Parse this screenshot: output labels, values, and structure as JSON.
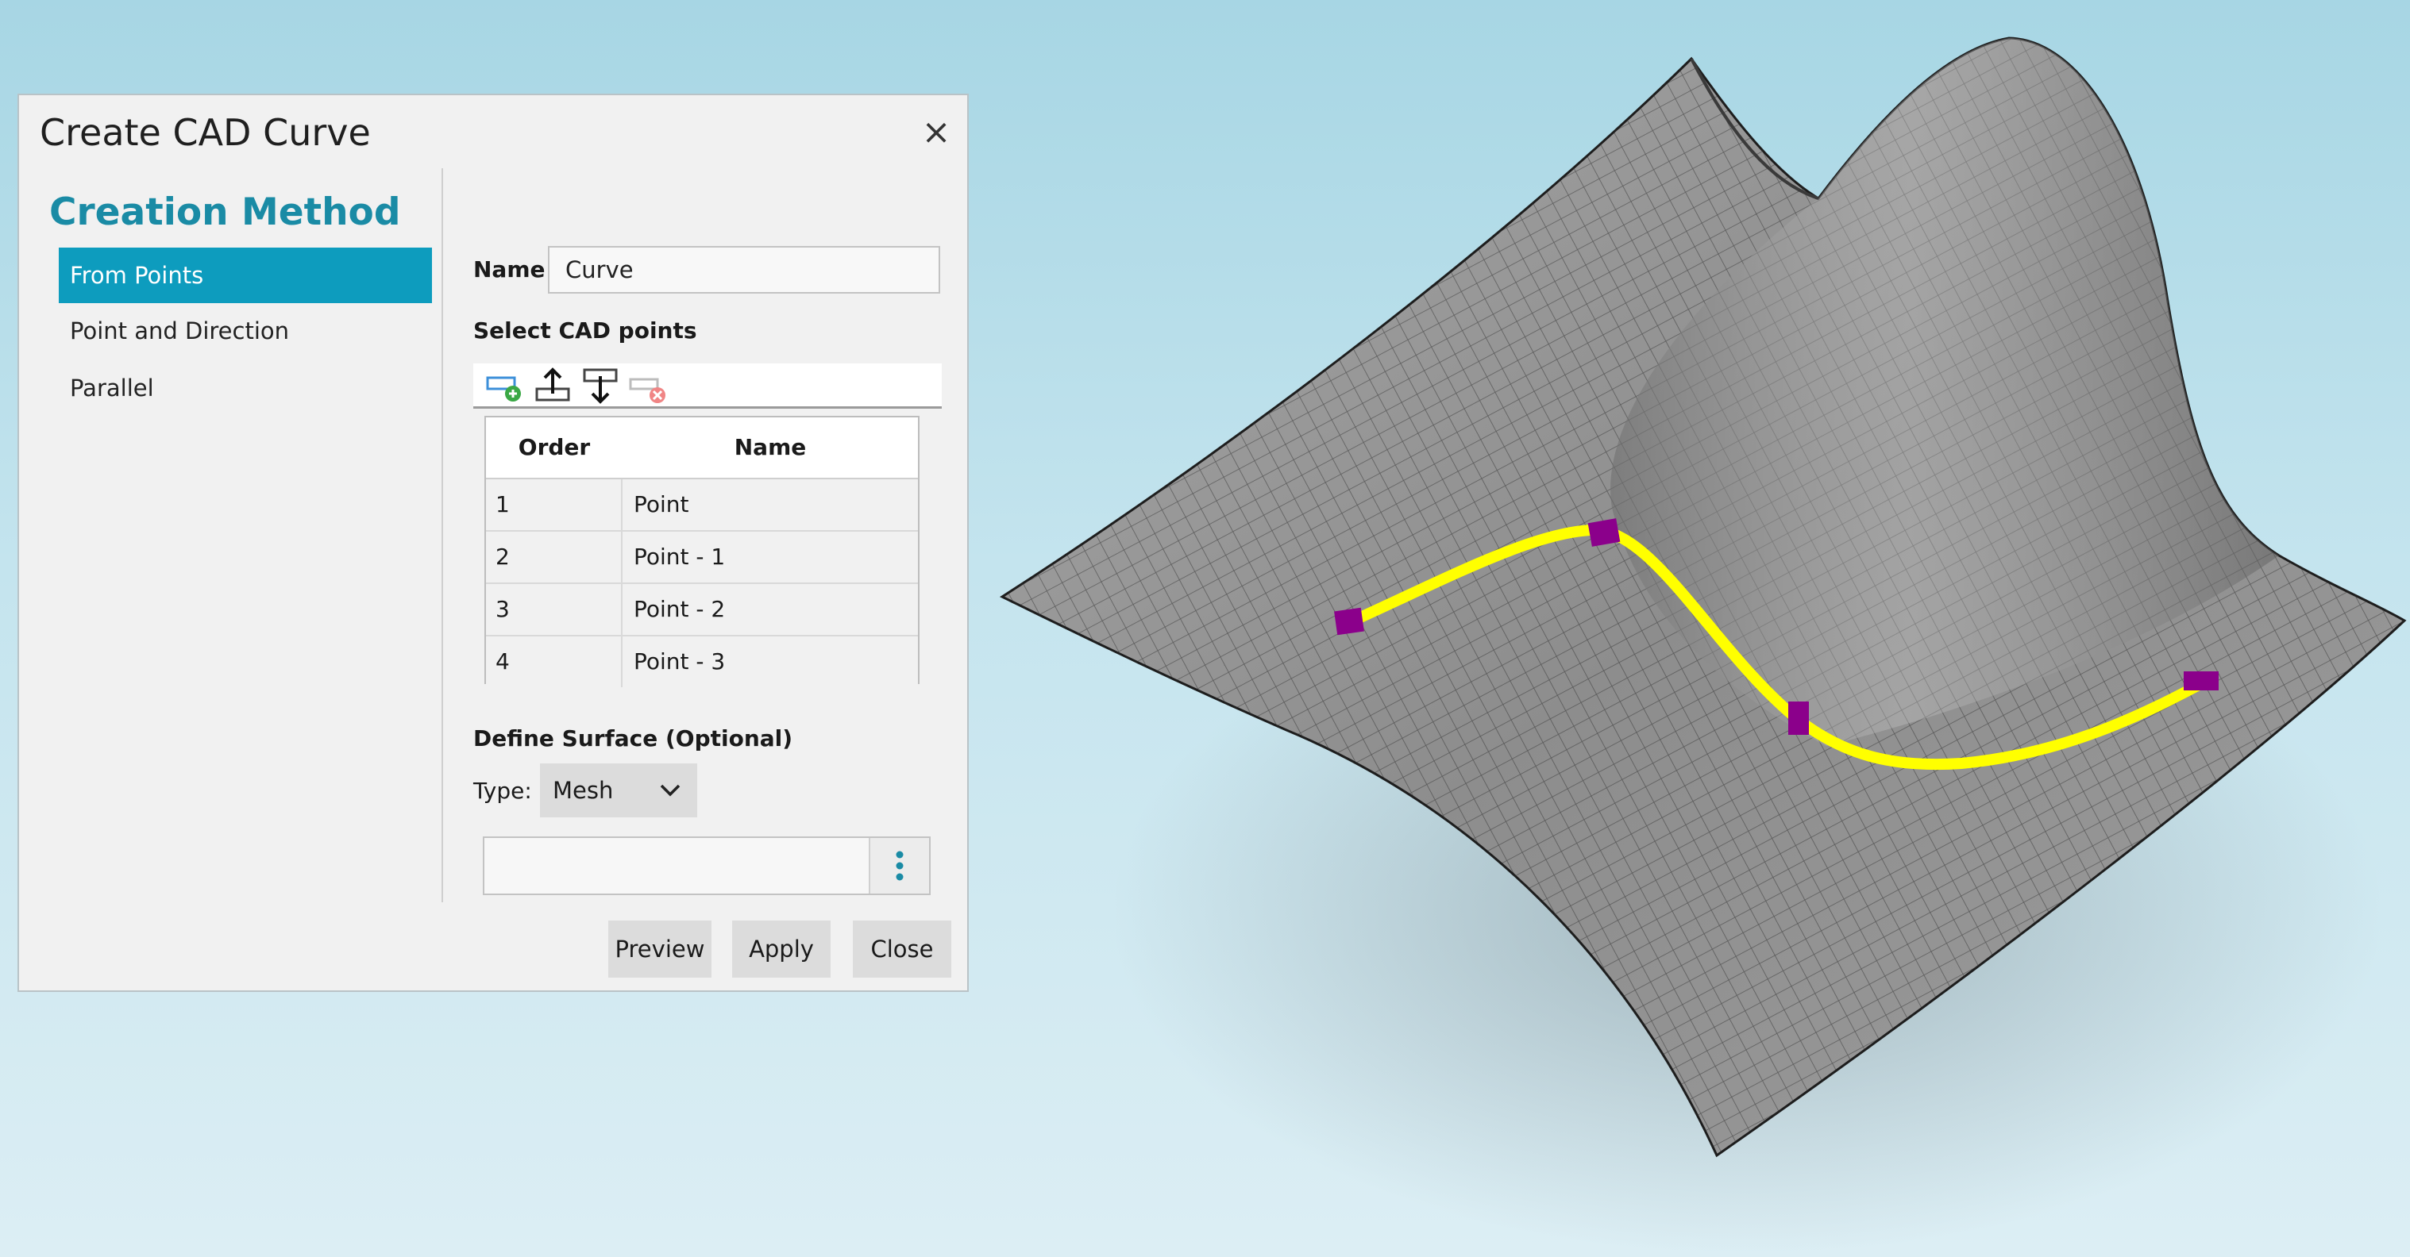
{
  "dialog": {
    "title": "Create CAD Curve",
    "close_label": "×"
  },
  "creation_method": {
    "heading": "Creation Method",
    "items": [
      {
        "label": "From Points",
        "active": true
      },
      {
        "label": "Point and Direction",
        "active": false
      },
      {
        "label": "Parallel",
        "active": false
      }
    ]
  },
  "name_field": {
    "label": "Name",
    "value": "Curve"
  },
  "select_points": {
    "label": "Select CAD points",
    "toolbar_icons": [
      "add-point-icon",
      "move-up-icon",
      "move-down-icon",
      "remove-point-icon"
    ],
    "columns": [
      "Order",
      "Name"
    ],
    "rows": [
      {
        "order": "1",
        "name": "Point"
      },
      {
        "order": "2",
        "name": "Point - 1"
      },
      {
        "order": "3",
        "name": "Point - 2"
      },
      {
        "order": "4",
        "name": "Point - 3"
      }
    ]
  },
  "define_surface": {
    "label": "Define Surface (Optional)",
    "type_label": "Type:",
    "type_value": "Mesh",
    "surface_value": ""
  },
  "buttons": {
    "preview": "Preview",
    "apply": "Apply",
    "close": "Close"
  },
  "colors": {
    "accent": "#0d9cbe",
    "heading": "#1a8ba5",
    "surface": "#999999",
    "curve": "#ffff00",
    "control_point": "#8b008b"
  }
}
